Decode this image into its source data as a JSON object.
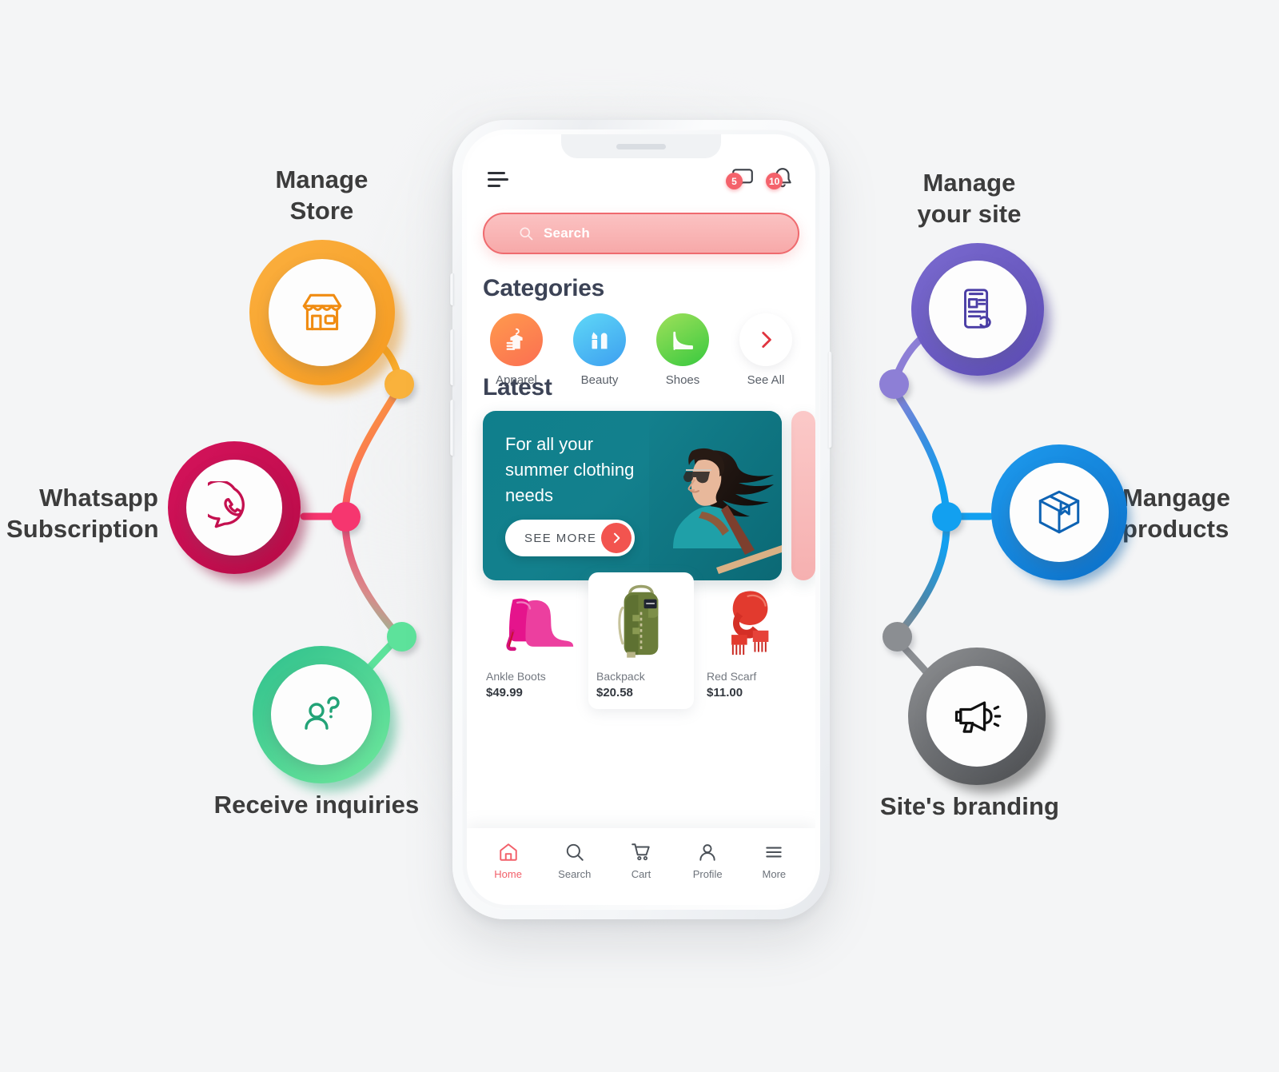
{
  "features": [
    {
      "id": "manage-store",
      "label": "Manage\nStore",
      "icon": "storefront-icon",
      "color": "#f6a028"
    },
    {
      "id": "whatsapp",
      "label": "Whatsapp\nSubscription",
      "icon": "whatsapp-icon",
      "color": "#c4104f"
    },
    {
      "id": "receive-inquiries",
      "label": "Receive inquiries",
      "icon": "person-question-icon",
      "color": "#2ab582"
    },
    {
      "id": "manage-your-site",
      "label": "Manage\nyour site",
      "icon": "phone-hand-icon",
      "color": "#5b4fb6"
    },
    {
      "id": "manage-products",
      "label": "Mangage\nproducts",
      "icon": "box-icon",
      "color": "#1389d8"
    },
    {
      "id": "site-branding",
      "label": "Site's branding",
      "icon": "megaphone-icon",
      "color": "#4a4a4a"
    }
  ],
  "phone": {
    "header": {
      "menu_icon": "hamburger-icon",
      "chat_icon": "chat-bubble-icon",
      "chat_badge": "5",
      "bell_icon": "bell-icon",
      "bell_badge": "10"
    },
    "search": {
      "icon": "search-icon",
      "placeholder": "Search",
      "value": ""
    },
    "categories": {
      "title": "Categories",
      "items": [
        {
          "label": "Apparel",
          "icon": "apparel-icon"
        },
        {
          "label": "Beauty",
          "icon": "lipstick-icon"
        },
        {
          "label": "Shoes",
          "icon": "heel-shoe-icon"
        },
        {
          "label": "See All",
          "icon": "chevron-right-icon"
        }
      ]
    },
    "latest": {
      "title": "Latest",
      "banner": {
        "headline": "For all your summer clothing needs",
        "cta_label": "SEE MORE",
        "cta_icon": "arrow-right-icon",
        "bg_color": "#11808d"
      }
    },
    "products": [
      {
        "name": "Ankle Boots",
        "price": "$49.99",
        "image": "pink-ankle-boots"
      },
      {
        "name": "Backpack",
        "price": "$20.58",
        "image": "green-backpack"
      },
      {
        "name": "Red Scarf",
        "price": "$11.00",
        "image": "red-scarf"
      }
    ],
    "nav": [
      {
        "label": "Home",
        "icon": "home-icon",
        "active": true
      },
      {
        "label": "Search",
        "icon": "search-icon",
        "active": false
      },
      {
        "label": "Cart",
        "icon": "cart-icon",
        "active": false
      },
      {
        "label": "Profile",
        "icon": "profile-icon",
        "active": false
      },
      {
        "label": "More",
        "icon": "more-icon",
        "active": false
      }
    ]
  }
}
